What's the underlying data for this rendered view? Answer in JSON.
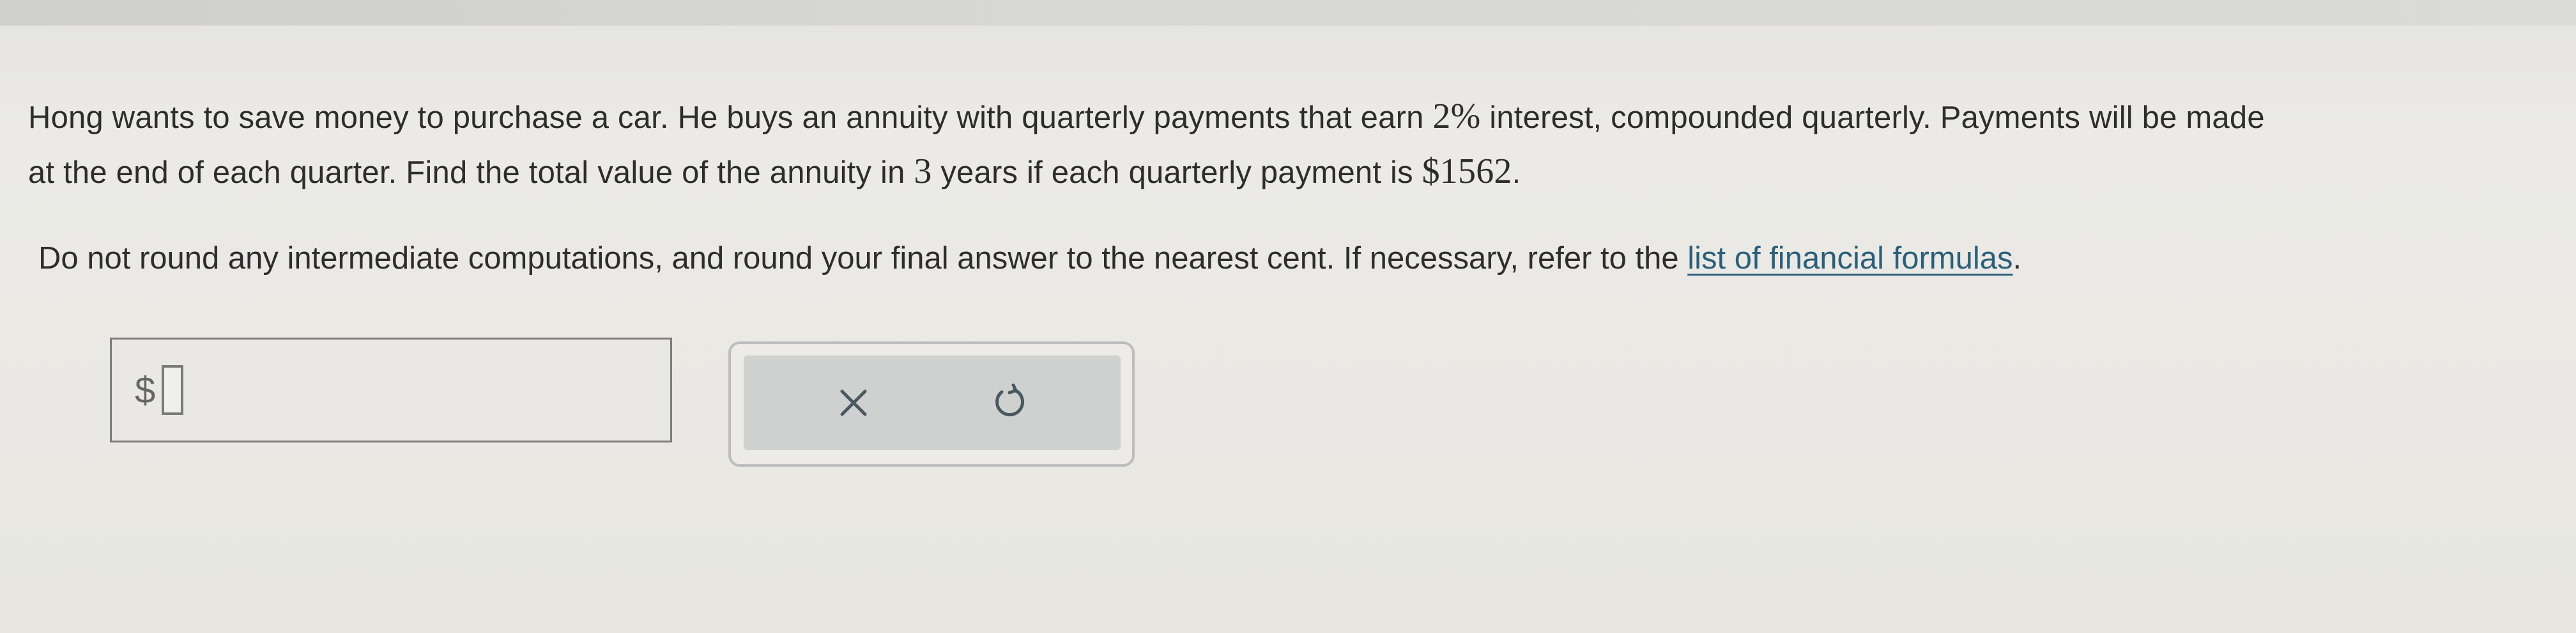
{
  "question": {
    "sentence_1_a": "Hong wants to save money to purchase a car. He buys an annuity with quarterly payments that earn ",
    "rate": "2%",
    "sentence_1_b": " interest, compounded quarterly. Payments will be made",
    "sentence_2_a": "at the end of each quarter. Find the total value of the annuity in ",
    "years": "3",
    "sentence_2_b": " years if each quarterly payment is ",
    "payment": "$1562",
    "sentence_2_c": "."
  },
  "instructions": {
    "text": "Do not round any intermediate computations, and round your final answer to the nearest cent. If necessary, refer to the ",
    "link_label": "list of financial formulas",
    "end": "."
  },
  "answer": {
    "currency_symbol": "$",
    "value": ""
  },
  "actions": {
    "clear_icon": "x-icon",
    "reset_icon": "undo-icon"
  },
  "colors": {
    "link": "#2b5f7a",
    "text": "#2d2d2d",
    "panel": "#cfd1d0"
  }
}
